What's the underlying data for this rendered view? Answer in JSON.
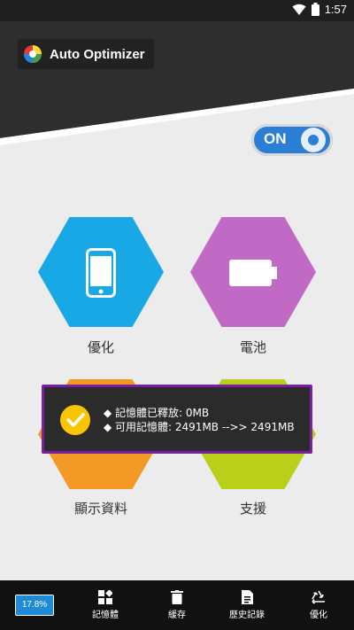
{
  "status_bar": {
    "time": "1:57",
    "icons": [
      "wifi-icon",
      "battery-icon"
    ]
  },
  "app": {
    "title": "Auto Optimizer"
  },
  "toggle": {
    "label": "ON",
    "state": true
  },
  "tiles": [
    {
      "label": "優化",
      "color": "#19a8e6",
      "icon": "phone-icon"
    },
    {
      "label": "電池",
      "color": "#c06ac6",
      "icon": "battery-icon"
    },
    {
      "label": "顯示資料",
      "color": "#f39a26",
      "icon": "info-icon"
    },
    {
      "label": "支援",
      "color": "#b9cf19",
      "icon": "support-icon"
    }
  ],
  "toast": {
    "line1": "◆ 記憶體已釋放: 0MB",
    "line2": "◆ 可用記憶體:  2491MB -->> 2491MB"
  },
  "bottom_nav": {
    "percent": "17.8%",
    "items": [
      {
        "label": "記憶體",
        "icon": "memory-icon"
      },
      {
        "label": "緩存",
        "icon": "trash-icon"
      },
      {
        "label": "歷史記錄",
        "icon": "document-icon"
      },
      {
        "label": "優化",
        "icon": "recycle-icon"
      }
    ]
  },
  "colors": {
    "accent_blue": "#2a7fd4",
    "toast_border": "#7b1fa2",
    "check": "#f9c400"
  }
}
